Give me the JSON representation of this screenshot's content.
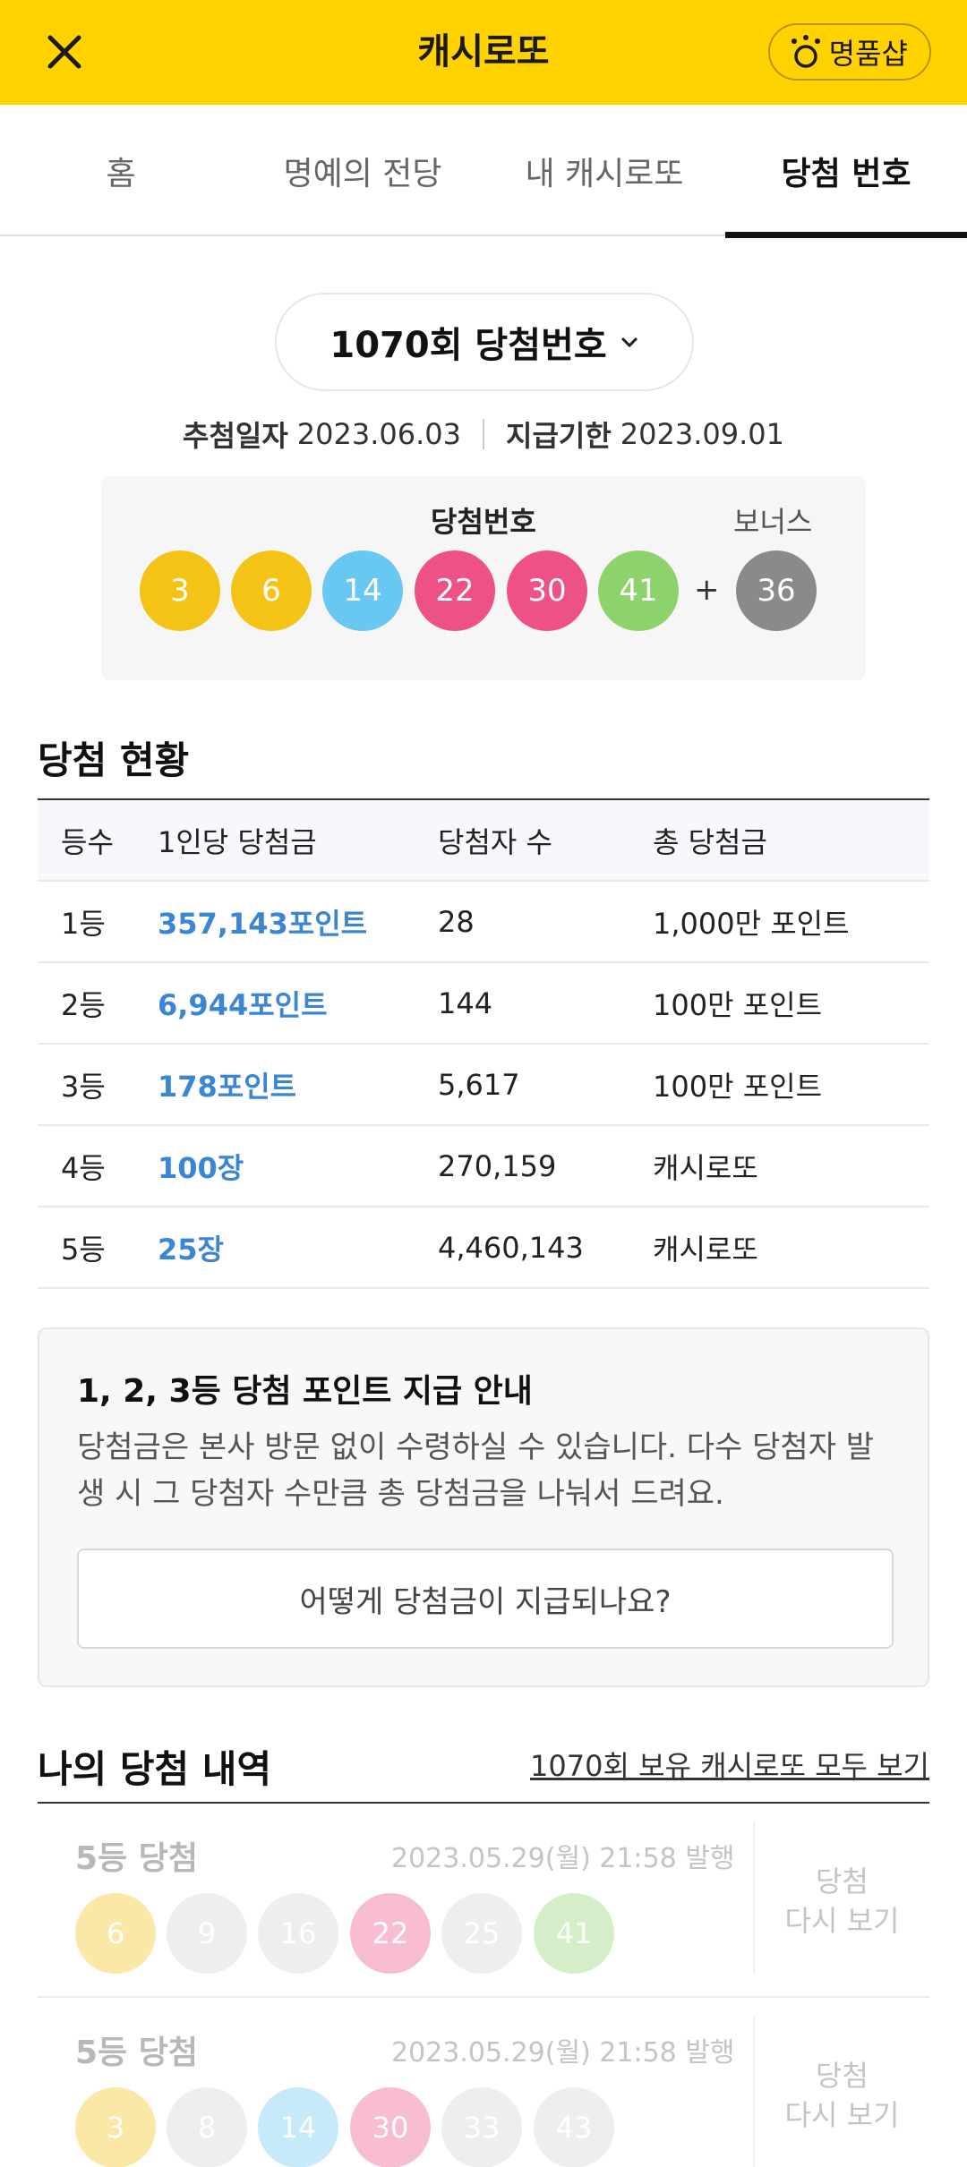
{
  "header": {
    "title": "캐시로또",
    "shop_label": "명품샵",
    "accent_color": "#ffd200"
  },
  "tabs": [
    {
      "label": "홈",
      "active": false
    },
    {
      "label": "명예의 전당",
      "active": false
    },
    {
      "label": "내 캐시로또",
      "active": false
    },
    {
      "label": "당첨 번호",
      "active": true
    }
  ],
  "round": {
    "label": "1070회 당첨번호",
    "draw_date_label": "추첨일자",
    "draw_date": "2023.06.03",
    "deadline_label": "지급기한",
    "deadline": "2023.09.01"
  },
  "winning_numbers": {
    "label": "당첨번호",
    "bonus_label": "보너스",
    "plus": "+",
    "numbers": [
      "3",
      "6",
      "14",
      "22",
      "30",
      "41"
    ],
    "bonus": "36",
    "ball_colors": {
      "yellow": "#f5c316",
      "blue": "#69c8f2",
      "red": "#ed5187",
      "gray": "#8a8a8a",
      "green": "#8dd36b"
    }
  },
  "status": {
    "title": "당첨 현황",
    "headers": [
      "등수",
      "1인당 당첨금",
      "당첨자 수",
      "총 당첨금"
    ],
    "rows": [
      {
        "rank": "1등",
        "prize": "357,143포인트",
        "winners": "28",
        "total": "1,000만 포인트"
      },
      {
        "rank": "2등",
        "prize": "6,944포인트",
        "winners": "144",
        "total": "100만 포인트"
      },
      {
        "rank": "3등",
        "prize": "178포인트",
        "winners": "5,617",
        "total": "100만 포인트"
      },
      {
        "rank": "4등",
        "prize": "100장",
        "winners": "270,159",
        "total": "캐시로또"
      },
      {
        "rank": "5등",
        "prize": "25장",
        "winners": "4,460,143",
        "total": "캐시로또"
      }
    ]
  },
  "info": {
    "title": "1, 2, 3등 당첨 포인트 지급 안내",
    "text": "당첨금은 본사 방문 없이 수령하실 수 있습니다. 다수 당첨자 발생 시 그 당첨자 수만큼 총 당첨금을 나눠서 드려요.",
    "button": "어떻게 당첨금이 지급되나요?"
  },
  "my_history": {
    "title": "나의 당첨 내역",
    "link": "1070회 보유 캐시로또 모두 보기",
    "again_line1": "당첨",
    "again_line2": "다시 보기",
    "tickets": [
      {
        "rank": "5등 당첨",
        "issued": "2023.05.29(월) 21:58 발행",
        "numbers": [
          "6",
          "9",
          "16",
          "22",
          "25",
          "41"
        ]
      },
      {
        "rank": "5등 당첨",
        "issued": "2023.05.29(월) 21:58 발행",
        "numbers": [
          "3",
          "8",
          "14",
          "30",
          "33",
          "43"
        ]
      }
    ]
  }
}
